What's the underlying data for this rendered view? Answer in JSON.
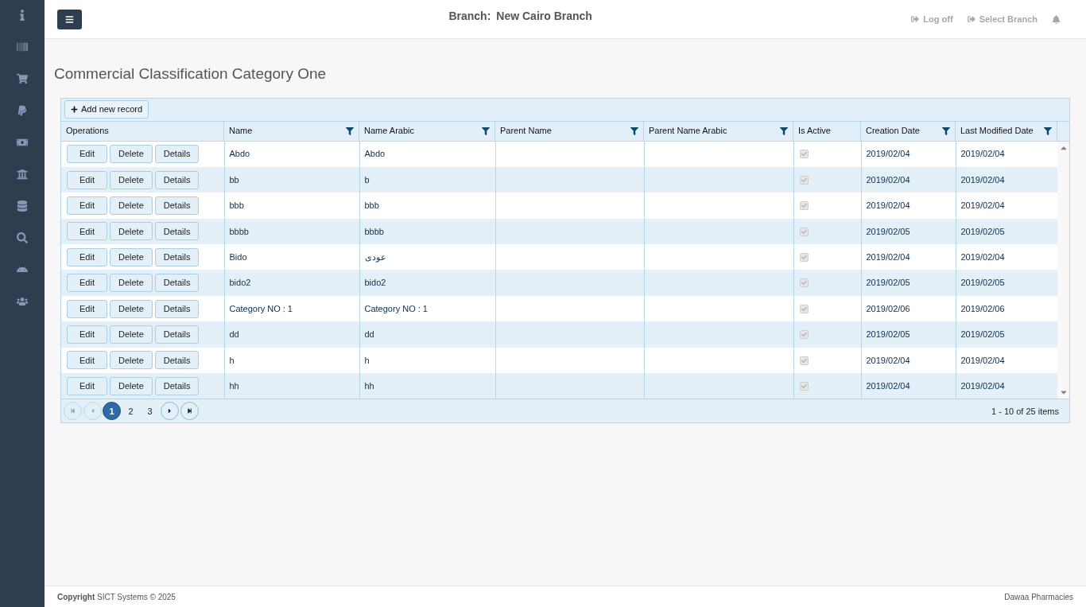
{
  "header": {
    "branch_label": "Branch:",
    "branch_name": "New Cairo Branch",
    "links": [
      "Log off",
      "Select Branch"
    ]
  },
  "page_title": "Commercial Classification Category One",
  "toolbar": {
    "add_button": "Add new record"
  },
  "table": {
    "columns": [
      {
        "label": "Operations",
        "filter": false
      },
      {
        "label": "Name",
        "filter": true
      },
      {
        "label": "Name Arabic",
        "filter": true
      },
      {
        "label": "Parent Name",
        "filter": true
      },
      {
        "label": "Parent Name Arabic",
        "filter": true
      },
      {
        "label": "Is Active",
        "filter": false
      },
      {
        "label": "Creation Date",
        "filter": true
      },
      {
        "label": "Last Modified Date",
        "filter": true
      }
    ],
    "rows": [
      {
        "operations": [
          "Edit",
          "Delete",
          "Details"
        ],
        "name": "Abdo",
        "name_arabic": "Abdo",
        "is_active": true,
        "creation_date": "2019/02/04",
        "last_modified_date": "2019/02/04"
      },
      {
        "operations": [
          "Edit",
          "Delete",
          "Details"
        ],
        "name": "bb",
        "name_arabic": "b",
        "is_active": true,
        "creation_date": "2019/02/04",
        "last_modified_date": "2019/02/04"
      },
      {
        "operations": [
          "Edit",
          "Delete",
          "Details"
        ],
        "name": "bbb",
        "name_arabic": "bbb",
        "is_active": true,
        "creation_date": "2019/02/04",
        "last_modified_date": "2019/02/04"
      },
      {
        "operations": [
          "Edit",
          "Delete",
          "Details"
        ],
        "name": "bbbb",
        "name_arabic": "bbbb",
        "is_active": true,
        "creation_date": "2019/02/05",
        "last_modified_date": "2019/02/05"
      },
      {
        "operations": [
          "Edit",
          "Delete",
          "Details"
        ],
        "name": "Bido",
        "name_arabic": "عودى",
        "is_active": true,
        "creation_date": "2019/02/04",
        "last_modified_date": "2019/02/04"
      },
      {
        "operations": [
          "Edit",
          "Delete",
          "Details"
        ],
        "name": "bido2",
        "name_arabic": "bido2",
        "is_active": true,
        "creation_date": "2019/02/05",
        "last_modified_date": "2019/02/05"
      },
      {
        "operations": [
          "Edit",
          "Delete",
          "Details"
        ],
        "name": "Category NO : 1",
        "name_arabic": "Category NO : 1",
        "is_active": true,
        "creation_date": "2019/02/06",
        "last_modified_date": "2019/02/06"
      },
      {
        "operations": [
          "Edit",
          "Delete",
          "Details"
        ],
        "name": "dd",
        "name_arabic": "dd",
        "is_active": true,
        "creation_date": "2019/02/05",
        "last_modified_date": "2019/02/05"
      },
      {
        "operations": [
          "Edit",
          "Delete",
          "Details"
        ],
        "name": "h",
        "name_arabic": "h",
        "is_active": true,
        "creation_date": "2019/02/04",
        "last_modified_date": "2019/02/04"
      },
      {
        "operations": [
          "Edit",
          "Delete",
          "Details"
        ],
        "name": "hh",
        "name_arabic": "hh",
        "is_active": true,
        "creation_date": "2019/02/04",
        "last_modified_date": "2019/02/04"
      }
    ]
  },
  "pager": {
    "pages": [
      {
        "label": "1",
        "selected": true
      },
      {
        "label": "2",
        "selected": false
      },
      {
        "label": "3",
        "selected": false
      }
    ],
    "summary": "1 - 10 of 25 items"
  },
  "footer": {
    "copyright": "**Copyright** SICT Systems © 2025",
    "company": "Dawaa Pharmacies"
  }
}
